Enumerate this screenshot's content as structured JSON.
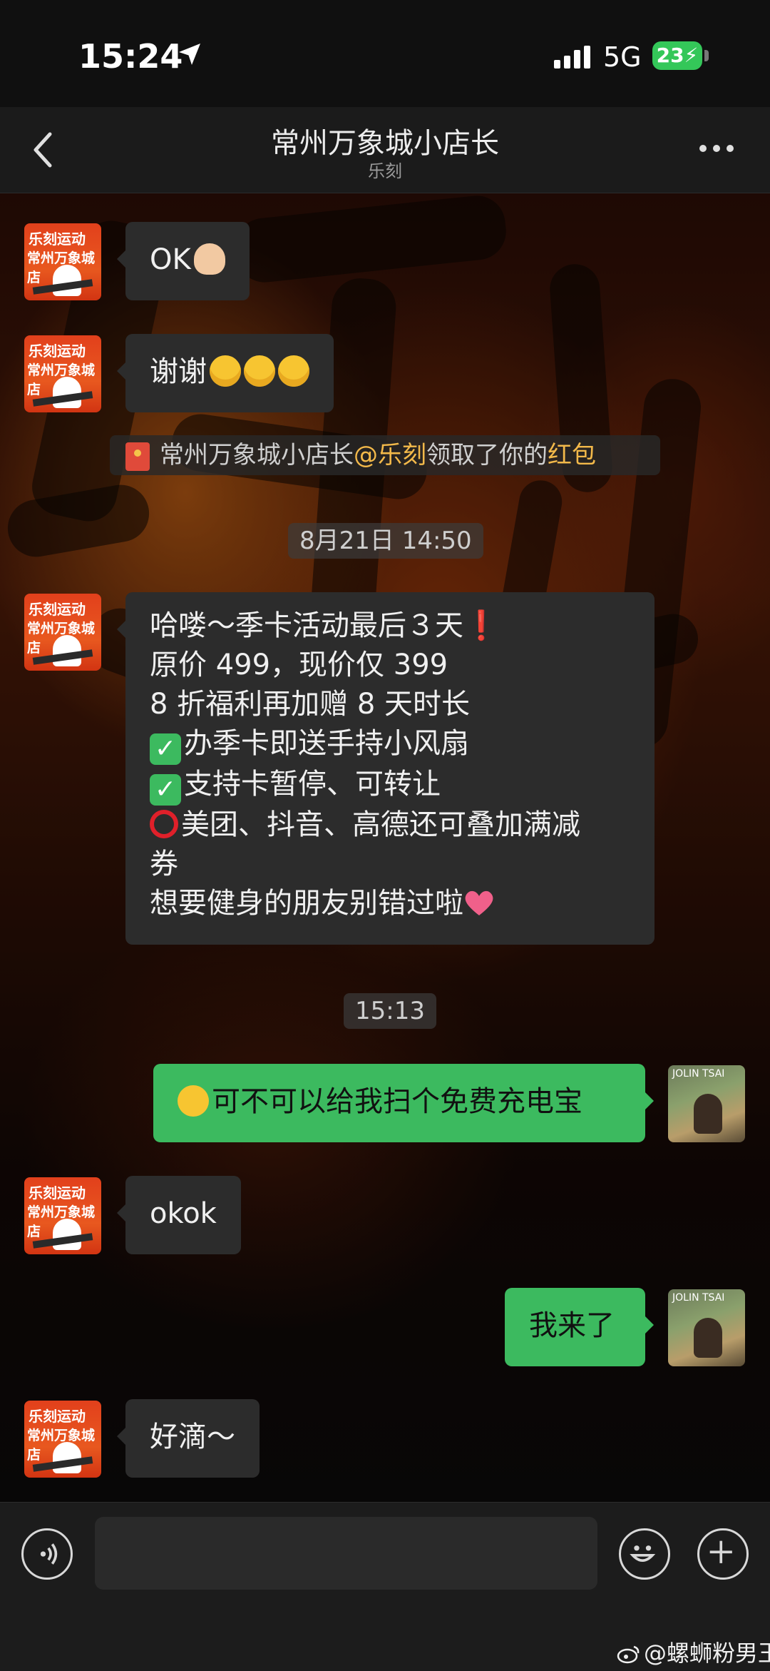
{
  "status_bar": {
    "time": "15:24",
    "network": "5G",
    "battery": "23"
  },
  "header": {
    "title": "常州万象城小店长",
    "subtitle": "乐刻"
  },
  "avatar_in": {
    "line1": "乐刻运动",
    "line2": "常州万象城店"
  },
  "avatar_out": {
    "label": "JOLIN TSAI"
  },
  "messages": {
    "m1": "OK",
    "m2": "谢谢",
    "system_pickup": {
      "prefix": "常州万象城小店长",
      "mention": "@乐刻",
      "middle": "领取了你的",
      "highlight": "红包"
    },
    "time1": "8月21日 14:50",
    "m3": {
      "l1": "哈喽～季卡活动最后３天",
      "l2": "原价 499，现价仅 399",
      "l3": "8 折福利再加赠 8 天时长",
      "l4": "办季卡即送手持小风扇",
      "l5": "支持卡暂停、可转让",
      "l6": "美团、抖音、高德还可叠加满减",
      "l7": "券",
      "l8": "想要健身的朋友别错过啦"
    },
    "time2": "15:13",
    "m4": "可不可以给我扫个免费充电宝",
    "m5": "okok",
    "m6": "我来了",
    "m7": "好滴～"
  },
  "input": {
    "value": ""
  },
  "watermark": "@螺蛳粉男王",
  "colors": {
    "bubble_in": "#2c2c2c",
    "bubble_out": "#3cba5f",
    "highlight": "#f3b94a"
  },
  "icons": [
    "location-arrow-icon",
    "signal-icon",
    "battery-icon",
    "back-chevron-icon",
    "more-dots-icon",
    "voice-icon",
    "emoji-icon",
    "plus-icon",
    "red-packet-icon",
    "weibo-icon"
  ]
}
